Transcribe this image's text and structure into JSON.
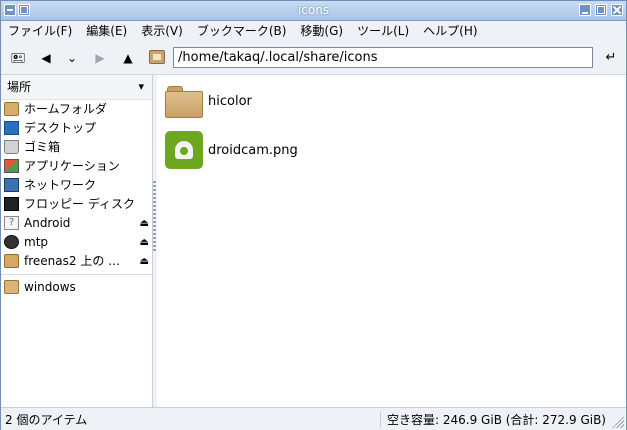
{
  "window": {
    "title": "icons"
  },
  "menubar": {
    "items": [
      {
        "label": "ファイル(F)"
      },
      {
        "label": "編集(E)"
      },
      {
        "label": "表示(V)"
      },
      {
        "label": "ブックマーク(B)"
      },
      {
        "label": "移動(G)"
      },
      {
        "label": "ツール(L)"
      },
      {
        "label": "ヘルプ(H)"
      }
    ]
  },
  "toolbar": {
    "location": "/home/takaq/.local/share/icons",
    "icons": {
      "new_window": "new-window-icon",
      "back": "back-arrow-icon",
      "history": "history-dropdown-icon",
      "forward": "forward-arrow-icon",
      "up": "up-arrow-icon",
      "home": "home-folder-icon",
      "go": "go-enter-icon"
    }
  },
  "sidebar": {
    "header": "場所",
    "items": [
      {
        "label": "ホームフォルダ",
        "icon": "home-folder-icon"
      },
      {
        "label": "デスクトップ",
        "icon": "desktop-icon"
      },
      {
        "label": "ゴミ箱",
        "icon": "trash-icon"
      },
      {
        "label": "アプリケーション",
        "icon": "applications-icon"
      },
      {
        "label": "ネットワーク",
        "icon": "network-icon"
      },
      {
        "label": "フロッピー ディスク",
        "icon": "floppy-icon"
      },
      {
        "label": "Android",
        "icon": "unknown-device-icon",
        "eject": true
      },
      {
        "label": "mtp",
        "icon": "disk-icon",
        "eject": true
      },
      {
        "label": "freenas2 上の …",
        "icon": "remote-share-icon",
        "eject": true
      }
    ],
    "bookmarks": [
      {
        "label": "windows",
        "icon": "folder-icon"
      }
    ]
  },
  "content": {
    "files": [
      {
        "name": "hicolor",
        "icon": "folder-icon"
      },
      {
        "name": "droidcam.png",
        "icon": "png-image-icon"
      }
    ]
  },
  "statusbar": {
    "item_count": "2 個のアイテム",
    "free_space": "空き容量: 246.9 GiB (合計: 272.9 GiB)"
  }
}
